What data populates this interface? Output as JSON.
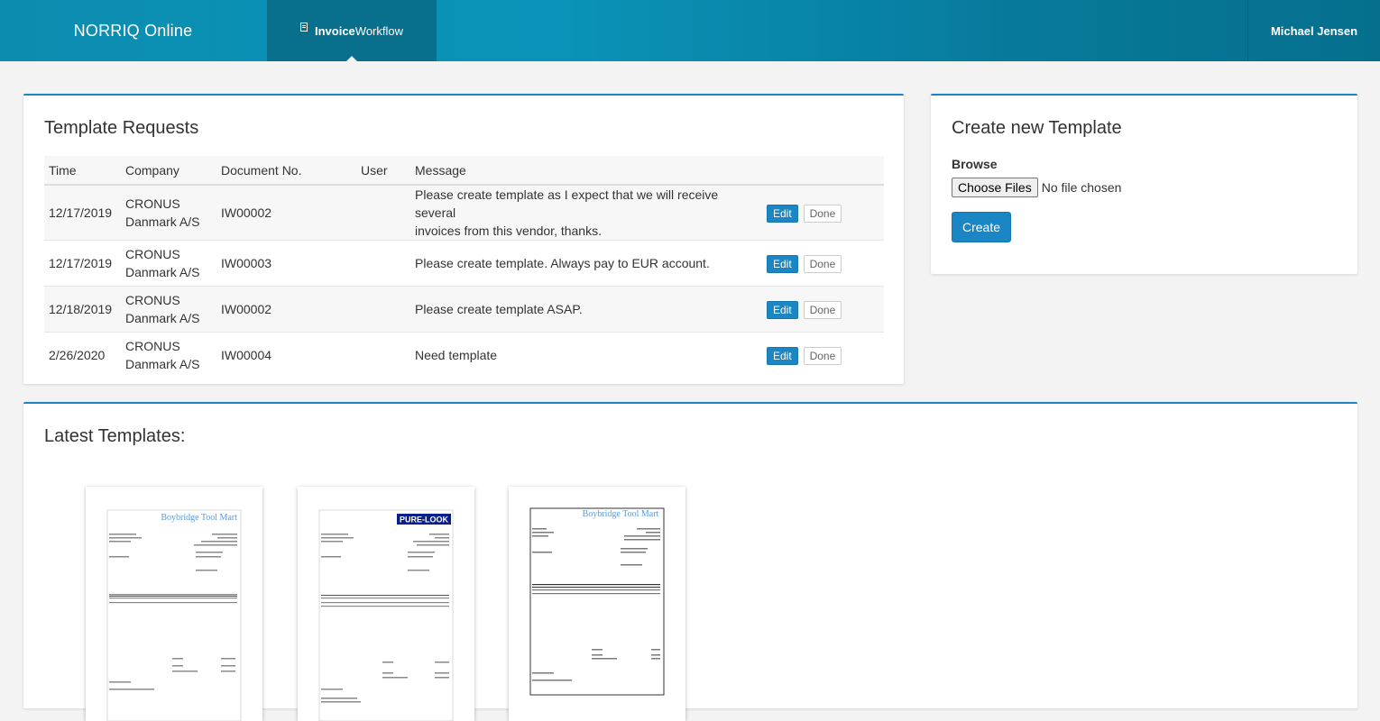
{
  "header": {
    "brand": "NORRIQ Online",
    "tab_bold": "Invoice",
    "tab_rest": "Workflow",
    "user": "Michael Jensen"
  },
  "requests": {
    "title": "Template Requests",
    "columns": [
      "Time",
      "Company",
      "Document No.",
      "User",
      "Message"
    ],
    "edit_label": "Edit",
    "done_label": "Done",
    "rows": [
      {
        "time": "12/17/2019",
        "company_l1": "CRONUS",
        "company_l2": "Danmark A/S",
        "doc": "IW00002",
        "user": "",
        "msg_l1": "Please create template as I expect that we will receive several",
        "msg_l2": "invoices from this vendor, thanks."
      },
      {
        "time": "12/17/2019",
        "company_l1": "CRONUS",
        "company_l2": "Danmark A/S",
        "doc": "IW00003",
        "user": "",
        "msg_l1": "Please create template. Always pay to EUR account.",
        "msg_l2": ""
      },
      {
        "time": "12/18/2019",
        "company_l1": "CRONUS",
        "company_l2": "Danmark A/S",
        "doc": "IW00002",
        "user": "",
        "msg_l1": "Please create template ASAP.",
        "msg_l2": ""
      },
      {
        "time": "2/26/2020",
        "company_l1": "CRONUS",
        "company_l2": "Danmark A/S",
        "doc": "IW00004",
        "user": "",
        "msg_l1": "Need template",
        "msg_l2": ""
      }
    ]
  },
  "create": {
    "title": "Create new Template",
    "browse_label": "Browse",
    "choose_label": "Choose Files",
    "no_file": "No file chosen",
    "create_label": "Create"
  },
  "latest": {
    "title": "Latest Templates:",
    "thumbs": [
      {
        "vendor": "Boybridge Tool Mart"
      },
      {
        "vendor": "PURE-LOOK"
      },
      {
        "vendor": "Boybridge Tool Mart"
      }
    ]
  }
}
